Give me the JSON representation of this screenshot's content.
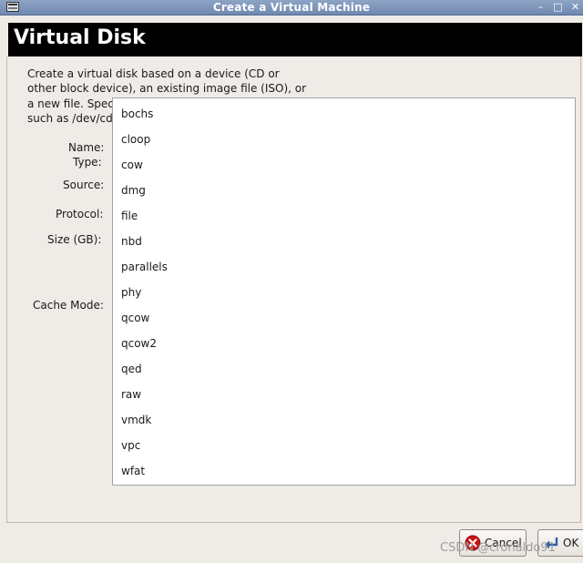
{
  "window": {
    "title": "Create a Virtual Machine",
    "controls": {
      "minimize": "–",
      "maximize": "□",
      "close": "✕"
    }
  },
  "header": {
    "title": "Virtual Disk"
  },
  "description": [
    "Create a virtual disk based on a device (CD or",
    "other block device), an existing image file (ISO), or",
    "a new file.  Spec",
    "such as /dev/cdr"
  ],
  "form": {
    "name_label": "Name:",
    "type_label": "Type:",
    "source_label": "Source:",
    "protocol_label": "Protocol:",
    "size_label": "Size (GB):",
    "cache_label": "Cache Mode:"
  },
  "dropdown": {
    "options": [
      "bochs",
      "cloop",
      "cow",
      "dmg",
      "file",
      "nbd",
      "parallels",
      "phy",
      "qcow",
      "qcow2",
      "qed",
      "raw",
      "vmdk",
      "vpc",
      "wfat"
    ]
  },
  "buttons": {
    "cancel": "Cancel",
    "ok": "OK"
  },
  "watermark": "CSDN @cronaldo91",
  "colors": {
    "banner": "#000000",
    "titlebar": "#7b93b8",
    "cancel_icon": "#cc1111",
    "ok_icon": "#2f5fa8"
  }
}
